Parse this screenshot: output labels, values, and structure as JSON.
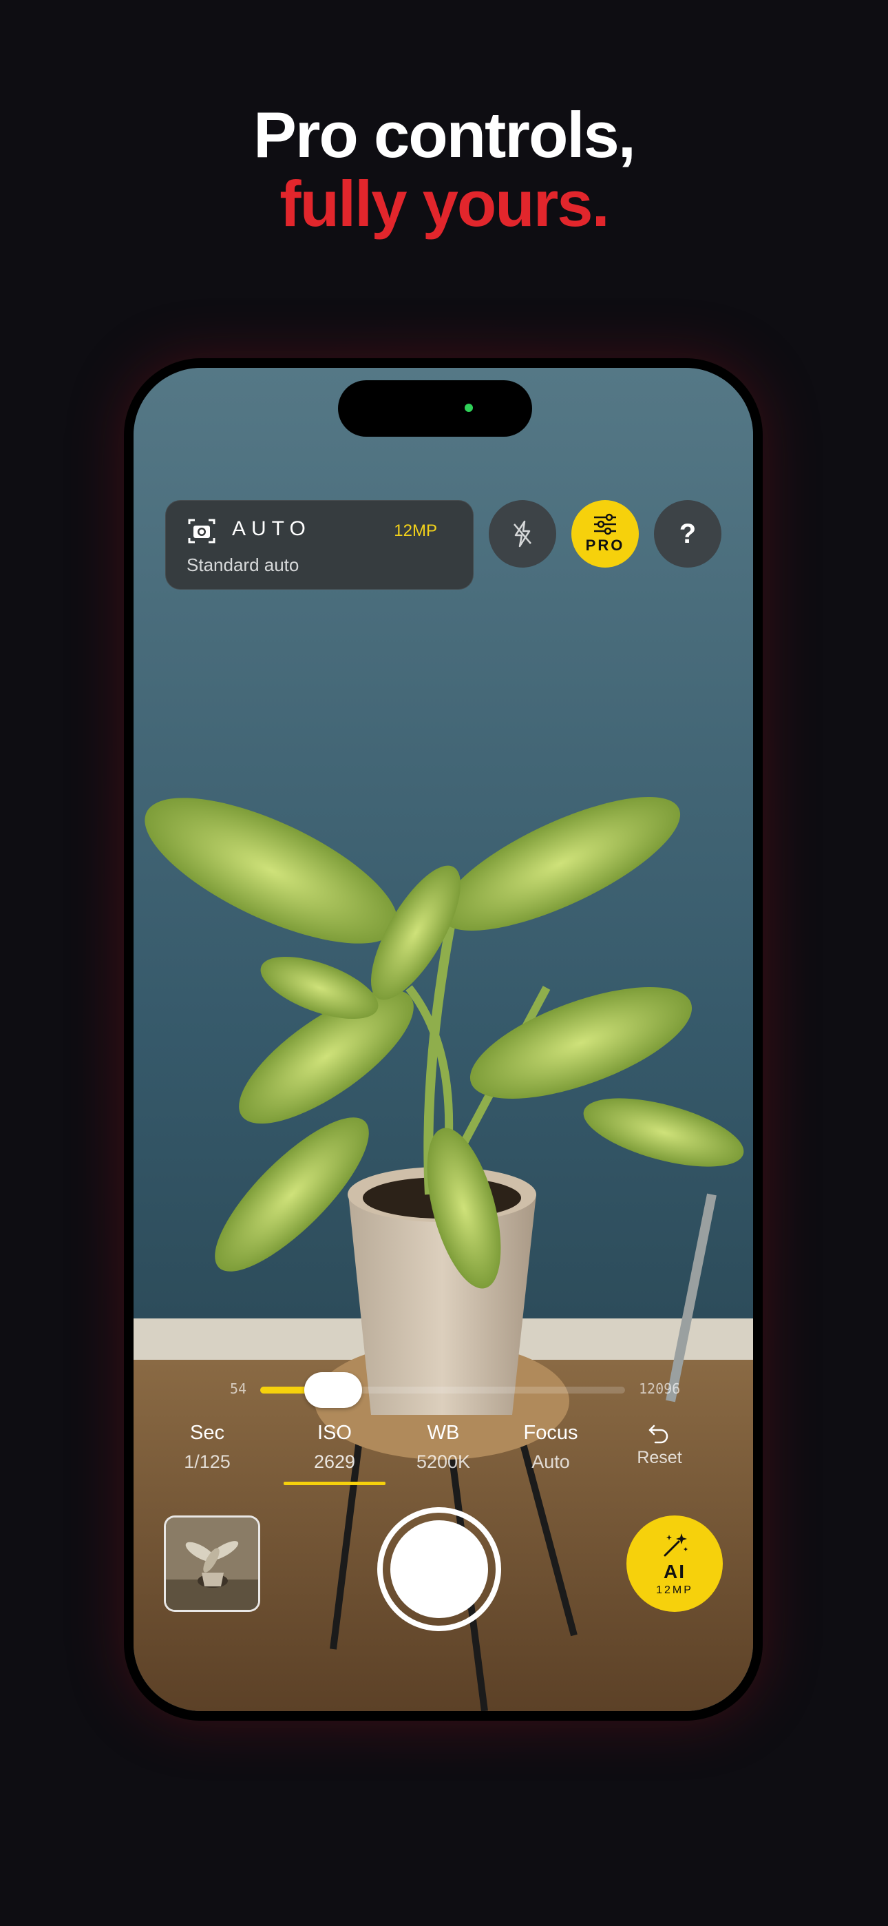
{
  "headline": {
    "line1": "Pro controls,",
    "line2": "fully yours."
  },
  "colors": {
    "accent_red": "#e2262c",
    "accent_yellow": "#f6d10c",
    "background": "#0e0d12"
  },
  "camera": {
    "mode": {
      "icon": "camera-icon",
      "name": "AUTO",
      "resolution": "12MP",
      "subtitle": "Standard auto"
    },
    "top_buttons": [
      {
        "icon": "flash-off-icon"
      },
      {
        "icon": "sliders-icon",
        "label": "PRO"
      },
      {
        "label": "?"
      }
    ],
    "slider": {
      "min": "54",
      "max": "12096",
      "position": 0.2
    },
    "params": [
      {
        "label": "Sec",
        "value": "1/125"
      },
      {
        "label": "ISO",
        "value": "2629",
        "active": true
      },
      {
        "label": "WB",
        "value": "5200K"
      },
      {
        "label": "Focus",
        "value": "Auto"
      }
    ],
    "reset": {
      "icon": "undo-icon",
      "label": "Reset"
    },
    "ai": {
      "icon": "magic-wand-icon",
      "label": "AI",
      "sub": "12MP"
    }
  }
}
